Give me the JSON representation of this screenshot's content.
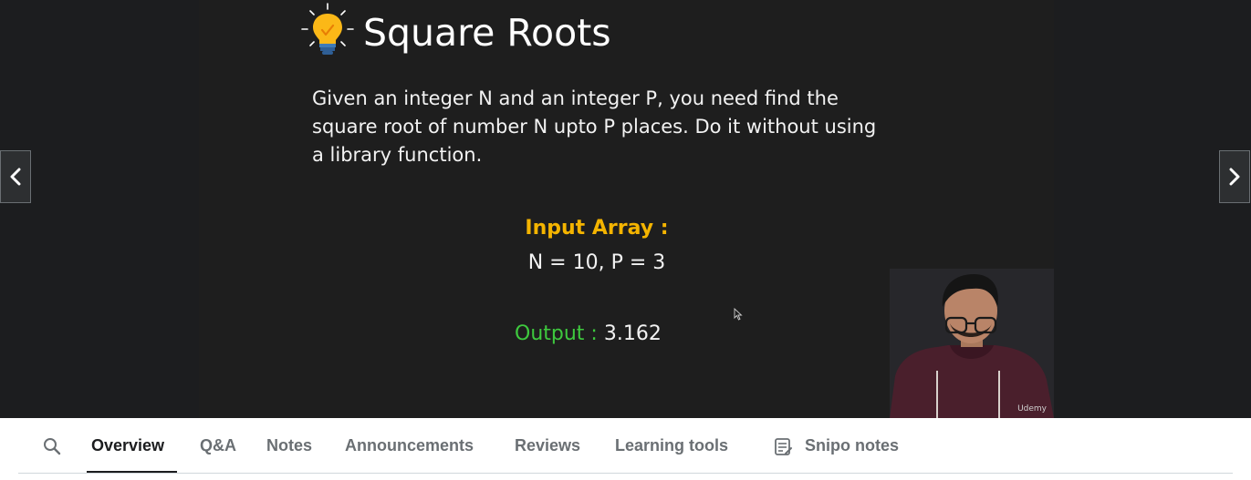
{
  "slide": {
    "title": "Square Roots",
    "description": "Given an integer N and an integer P, you need find the square root of number N upto P places. Do it without using a library function.",
    "input_label": "Input Array :",
    "input_values": "N = 10, P = 3",
    "output_label": "Output  : ",
    "output_value": "3.162",
    "title_icon": "lightbulb-icon"
  },
  "player": {
    "prev_icon": "chevron-left-icon",
    "next_icon": "chevron-right-icon",
    "watermark": "Udemy"
  },
  "tabs": {
    "search_icon": "search-icon",
    "items": [
      {
        "label": "Overview",
        "active": true
      },
      {
        "label": "Q&A"
      },
      {
        "label": "Notes"
      },
      {
        "label": "Announcements"
      },
      {
        "label": "Reviews"
      },
      {
        "label": "Learning tools"
      },
      {
        "label": "Snipo notes",
        "icon": "notes-icon"
      }
    ]
  },
  "colors": {
    "input_label": "#f4b400",
    "output_label": "#3ec93e",
    "slide_background": "#1e1e1e",
    "player_background": "#1c1d1f"
  }
}
